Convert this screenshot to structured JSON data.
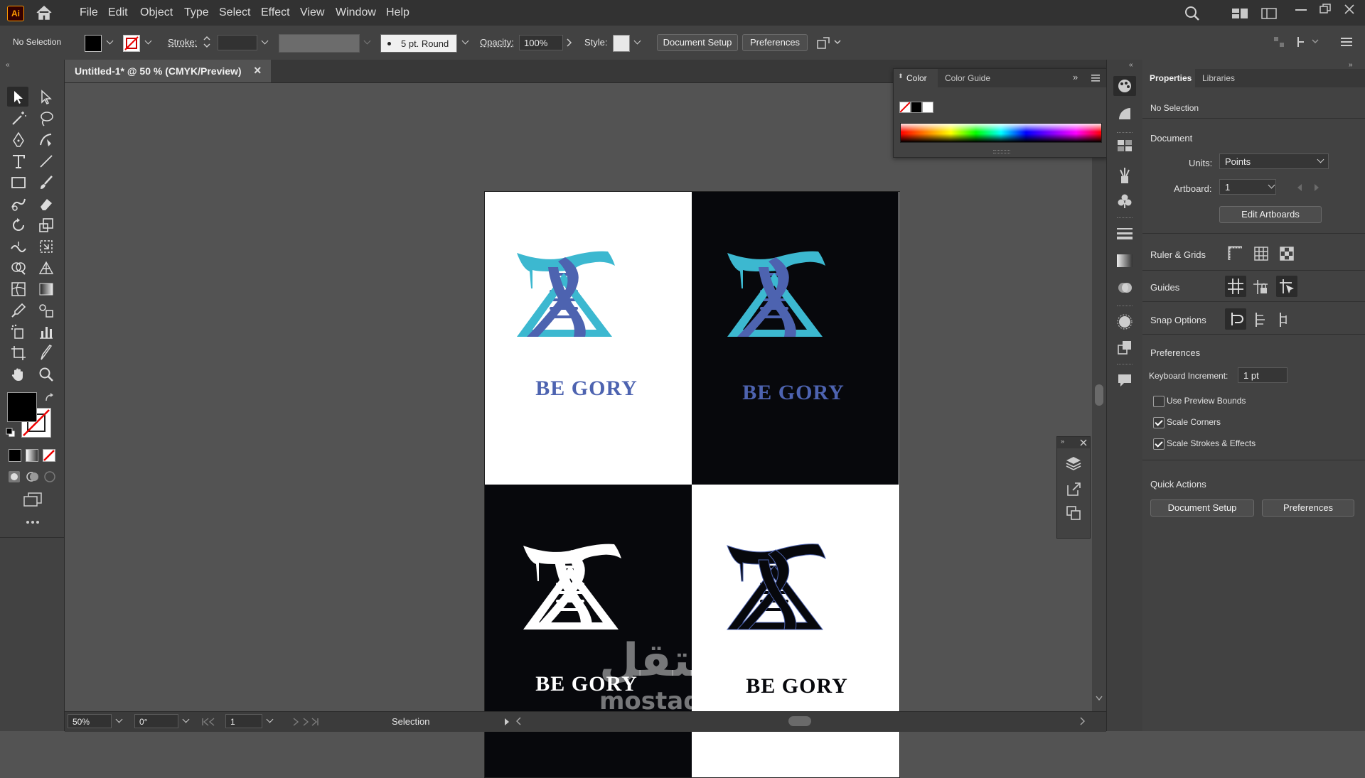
{
  "app": {
    "logo_text": "Ai"
  },
  "menu": [
    "File",
    "Edit",
    "Object",
    "Type",
    "Select",
    "Effect",
    "View",
    "Window",
    "Help"
  ],
  "control_bar": {
    "selection_state": "No Selection",
    "stroke_label": "Stroke:",
    "brush_label": "5 pt. Round",
    "opacity_label": "Opacity:",
    "opacity_value": "100%",
    "style_label": "Style:",
    "document_setup": "Document Setup",
    "preferences": "Preferences"
  },
  "tab": {
    "title": "Untitled-1* @ 50 % (CMYK/Preview)",
    "close": "×"
  },
  "color_panel": {
    "tabs": [
      "Color",
      "Color Guide"
    ]
  },
  "artwork": {
    "brand_text": "BE GORY",
    "colors": {
      "cyan": "#3cb8d0",
      "blue": "#4d63b0",
      "black": "#07080c",
      "white": "#ffffff"
    }
  },
  "status": {
    "zoom": "50%",
    "rotation": "0°",
    "artboard": "1",
    "tool": "Selection"
  },
  "properties": {
    "tabs": [
      "Properties",
      "Libraries"
    ],
    "selection": "No Selection",
    "document_header": "Document",
    "units_label": "Units:",
    "units_value": "Points",
    "artboard_label": "Artboard:",
    "artboard_value": "1",
    "edit_artboards": "Edit Artboards",
    "ruler_grids": "Ruler & Grids",
    "guides": "Guides",
    "snap_options": "Snap Options",
    "preferences_header": "Preferences",
    "keyboard_increment_label": "Keyboard Increment:",
    "keyboard_increment_value": "1 pt",
    "use_preview_bounds": "Use Preview Bounds",
    "scale_corners": "Scale Corners",
    "scale_strokes": "Scale Strokes & Effects",
    "quick_actions": "Quick Actions",
    "qa_document_setup": "Document Setup",
    "qa_preferences": "Preferences"
  },
  "watermark": {
    "arabic": "مستقل",
    "latin": "mostaql.com"
  }
}
